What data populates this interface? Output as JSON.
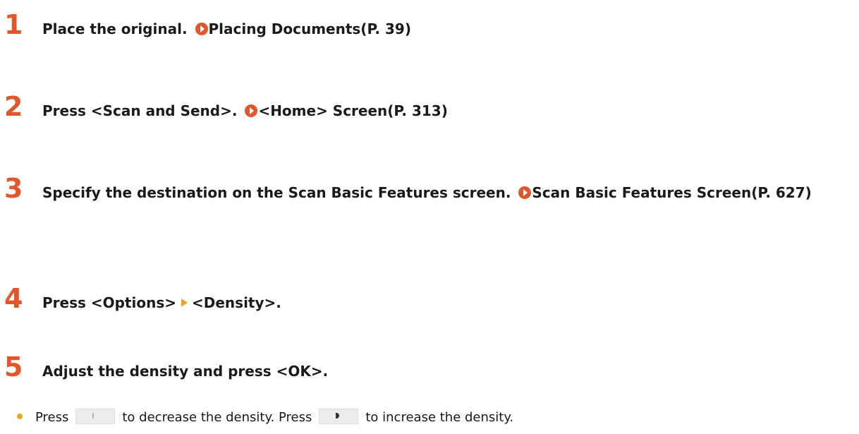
{
  "steps": [
    {
      "number": "1",
      "text": "Place the original.",
      "link": "Placing Documents(P. 39)"
    },
    {
      "number": "2",
      "text": "Press <Scan and Send>.",
      "link": "<Home> Screen(P. 313)"
    },
    {
      "number": "3",
      "text": "Specify the destination on the Scan Basic Features screen.",
      "link": "Scan Basic Features Screen(P. 627)"
    },
    {
      "number": "4",
      "text_before": "Press <Options>",
      "text_after": "<Density>."
    },
    {
      "number": "5",
      "text": "Adjust the density and press <OK>."
    }
  ],
  "bullet": {
    "press_1": "Press",
    "middle": "to decrease the density. Press",
    "end": "to increase the density.",
    "decrease_key_icon": "density-decrease-icon",
    "increase_key_icon": "density-increase-icon"
  },
  "colors": {
    "step_number": "#e2562c",
    "link_icon": "#e2562c",
    "separator_arrow": "#f0a21d",
    "bullet": "#f0a21d"
  }
}
